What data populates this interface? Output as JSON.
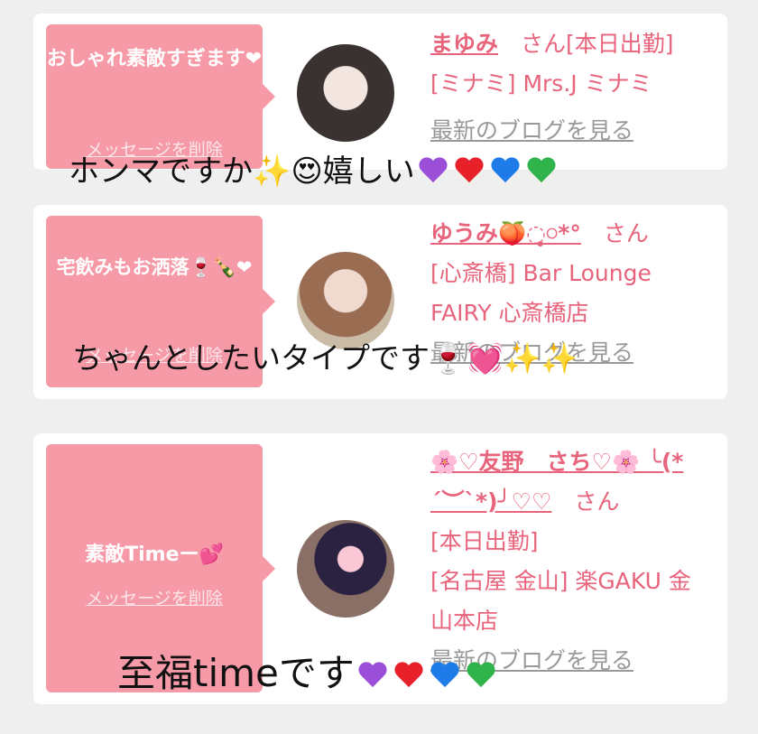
{
  "colors": {
    "accent": "#f69aa8",
    "name": "#e8647c",
    "blog": "#999999"
  },
  "cards": [
    {
      "message": "おしゃれ素敵すぎます❤",
      "delete_label": "メッセージを削除",
      "name": "まゆみ",
      "san": "さん",
      "status": "[本日出勤]",
      "shop": "[ミナミ] Mrs.J ミナミ",
      "blog_label": "最新のブログを見る",
      "caption": "ホンマですか✨😍嬉しい",
      "caption_icons": [
        "purple-heart-icon",
        "red-heart-icon",
        "blue-heart-icon",
        "green-heart-icon"
      ]
    },
    {
      "message": "宅飲みもお洒落🍷🍾❤",
      "delete_label": "メッセージを削除",
      "name": "ゆうみ🍑◌̥̥𓏸*°",
      "san": "さん",
      "shop": "[心斎橋] Bar Lounge FAIRY 心斎橋店",
      "blog_label": "最新のブログを見る",
      "caption": "ちゃんとしたいタイプです🍷💓✨✨"
    },
    {
      "message": "素敵Timeー💕",
      "delete_label": "メッセージを削除",
      "name": "🌸♡友野　さち♡🌸 ╰(*´︶`*)╯♡♡",
      "san": "さん",
      "status": "[本日出勤]",
      "shop": "[名古屋 金山] 楽GAKU 金山本店",
      "blog_label": "最新のブログを見る",
      "caption": "至福timeです",
      "caption_icons": [
        "purple-heart-icon",
        "red-heart-icon",
        "blue-heart-icon",
        "green-heart-icon"
      ]
    }
  ]
}
